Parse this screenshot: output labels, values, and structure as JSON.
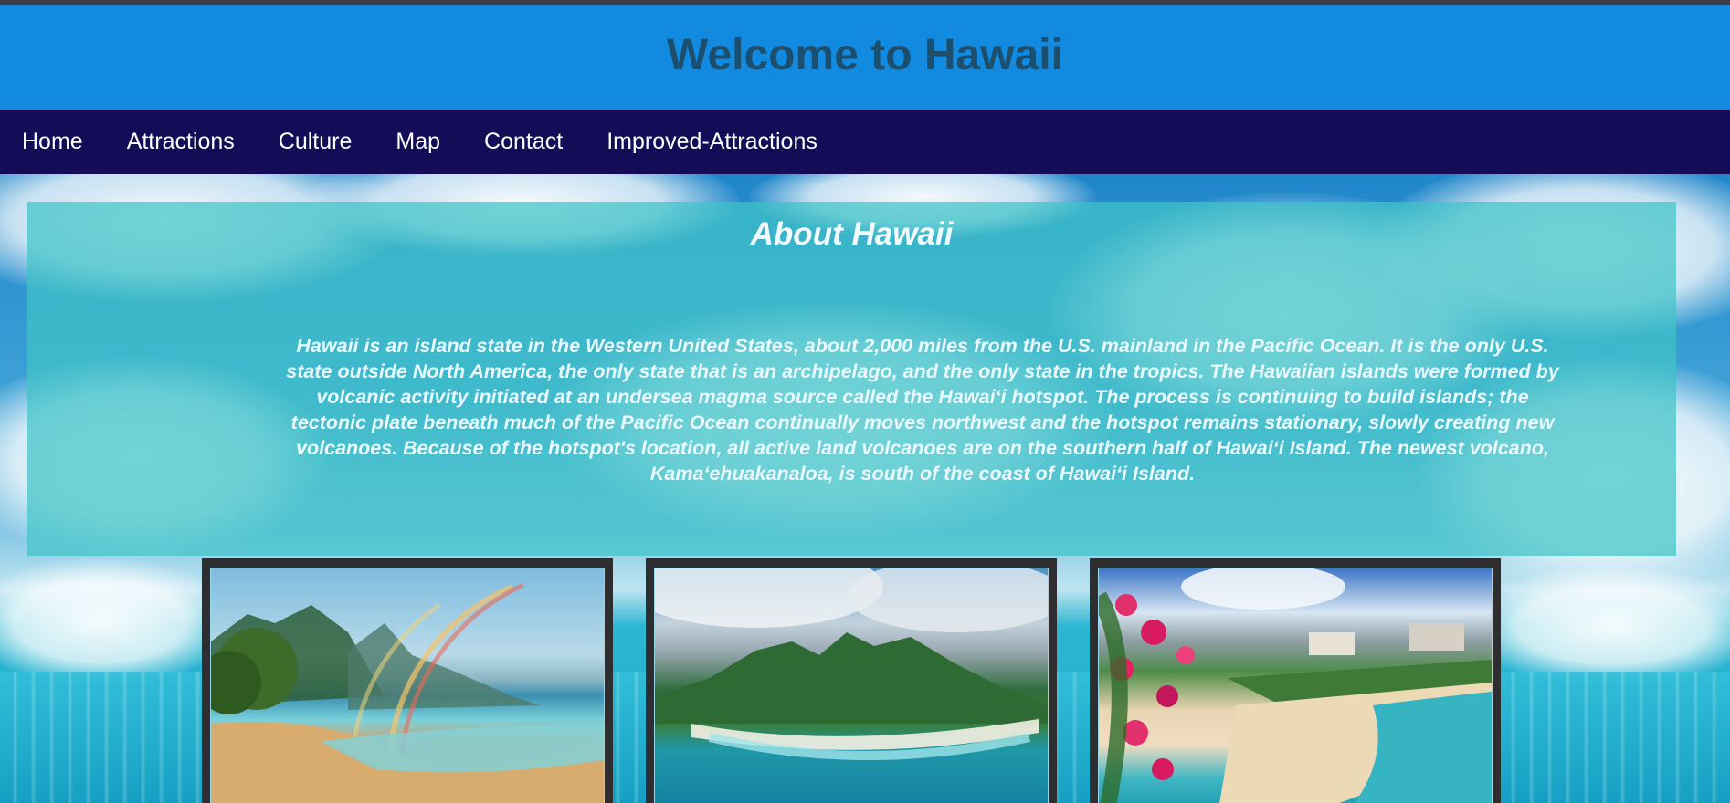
{
  "header": {
    "title": "Welcome to Hawaii"
  },
  "nav": {
    "items": [
      {
        "label": "Home"
      },
      {
        "label": "Attractions"
      },
      {
        "label": "Culture"
      },
      {
        "label": "Map"
      },
      {
        "label": "Contact"
      },
      {
        "label": "Improved-Attractions"
      }
    ]
  },
  "about": {
    "heading": "About Hawaii",
    "text": "Hawaii is an island state in the Western United States, about 2,000 miles from the U.S. mainland in the Pacific Ocean. It is the only U.S. state outside North America, the only state that is an archipelago, and the only state in the tropics. The Hawaiian islands were formed by volcanic activity initiated at an undersea magma source called the Hawaiʻi hotspot. The process is continuing to build islands; the tectonic plate beneath much of the Pacific Ocean continually moves northwest and the hotspot remains stationary, slowly creating new volcanoes. Because of the hotspot's location, all active land volcanoes are on the southern half of Hawaiʻi Island. The newest volcano, Kamaʻehuakanaloa, is south of the coast of Hawaiʻi Island."
  },
  "gallery": {
    "photos": [
      {
        "subject": "rainbow-beach"
      },
      {
        "subject": "aerial-island-coast"
      },
      {
        "subject": "resort-beach-with-flowers"
      }
    ]
  },
  "colors": {
    "header_bg": "#118ae0",
    "title_color": "#1c4f6e",
    "nav_bg": "#150c57",
    "panel_bg": "rgba(64,196,200,0.72)",
    "card_frame": "#2e2e30"
  }
}
